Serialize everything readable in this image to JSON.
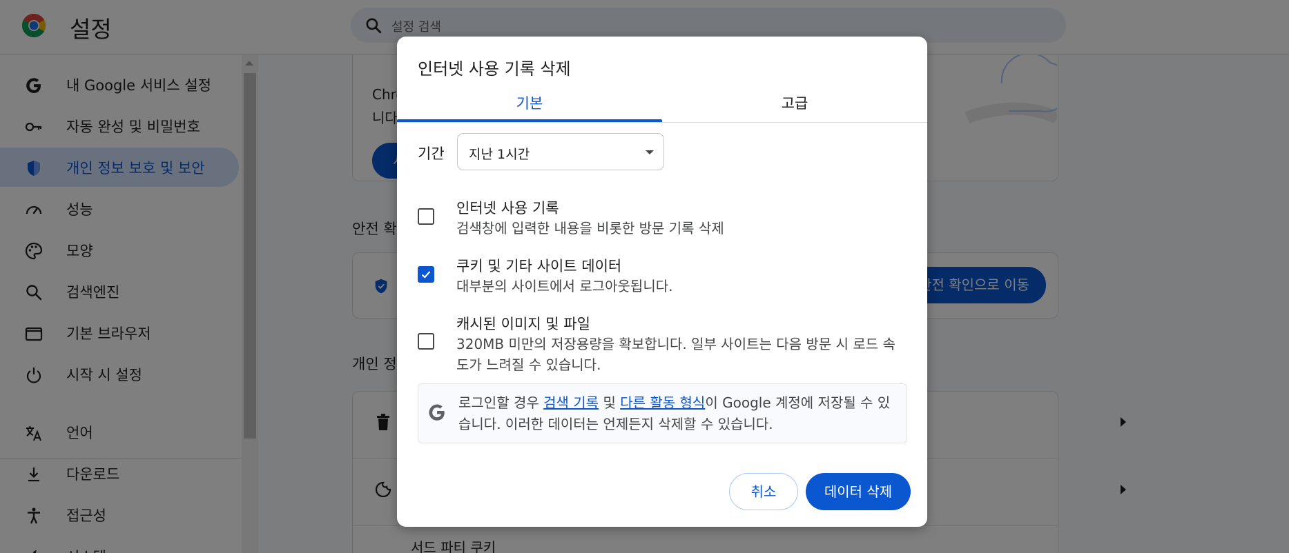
{
  "header": {
    "app_title": "설정",
    "search_placeholder": "설정 검색"
  },
  "sidebar": {
    "items": [
      {
        "label": "내 Google 서비스 설정",
        "icon": "google-g-icon"
      },
      {
        "label": "자동 완성 및 비밀번호",
        "icon": "key-icon"
      },
      {
        "label": "개인 정보 보호 및 보안",
        "icon": "shield-icon",
        "active": true
      },
      {
        "label": "성능",
        "icon": "speedometer-icon"
      },
      {
        "label": "모양",
        "icon": "palette-icon"
      },
      {
        "label": "검색엔진",
        "icon": "search-icon"
      },
      {
        "label": "기본 브라우저",
        "icon": "browser-window-icon"
      },
      {
        "label": "시작 시 설정",
        "icon": "power-icon"
      },
      {
        "label": "언어",
        "icon": "translate-icon"
      },
      {
        "label": "다운로드",
        "icon": "download-icon"
      },
      {
        "label": "접근성",
        "icon": "accessibility-icon"
      },
      {
        "label": "시스템",
        "icon": "wrench-icon"
      }
    ]
  },
  "main": {
    "card1_line1": "Chro",
    "card1_line2": "니다",
    "card1_button": "시",
    "safety_heading": "안전 확",
    "safety_button": "안전 확인으로 이동",
    "privacy_heading": "개인 정",
    "third_party_cookies": "서드 파티 쿠키"
  },
  "dialog": {
    "title": "인터넷 사용 기록 삭제",
    "tabs": [
      {
        "label": "기본",
        "active": true
      },
      {
        "label": "고급",
        "active": false
      }
    ],
    "period_label": "기간",
    "period_value": "지난 1시간",
    "options": [
      {
        "title": "인터넷 사용 기록",
        "description": "검색창에 입력한 내용을 비롯한 방문 기록 삭제",
        "checked": false
      },
      {
        "title": "쿠키 및 기타 사이트 데이터",
        "description": "대부분의 사이트에서 로그아웃됩니다.",
        "checked": true
      },
      {
        "title": "캐시된 이미지 및 파일",
        "description": "320MB 미만의 저장용량을 확보합니다. 일부 사이트는 다음 방문 시 로드 속도가 느려질 수 있습니다.",
        "checked": false
      }
    ],
    "info": {
      "prefix": "로그인할 경우 ",
      "link1": "검색 기록",
      "middle": " 및 ",
      "link2": "다른 활동 형식",
      "suffix": "이 Google 계정에 저장될 수 있습니다. 이러한 데이터는 언제든지 삭제할 수 있습니다."
    },
    "cancel_label": "취소",
    "delete_label": "데이터 삭제"
  },
  "colors": {
    "accent": "#0b57d0",
    "active_nav_bg": "#d3e3fd",
    "scrim": "rgba(0,0,0,0.5)"
  }
}
